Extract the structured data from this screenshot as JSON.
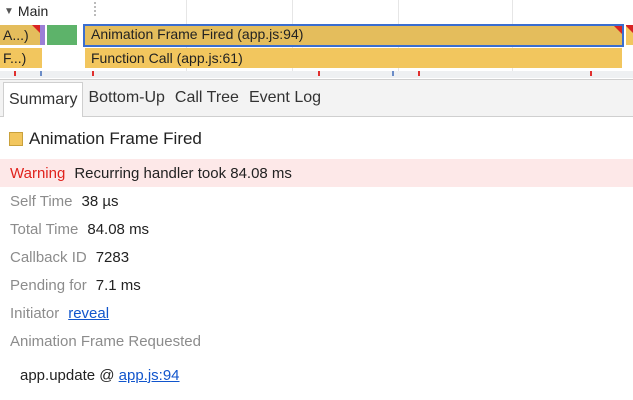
{
  "flame": {
    "main_label": "Main",
    "bars": {
      "left_top": "A...)",
      "left_bottom": "F...)",
      "animation_frame": "Animation Frame Fired (app.js:94)",
      "function_call": "Function Call (app.js:61)"
    }
  },
  "tabs": [
    "Summary",
    "Bottom-Up",
    "Call Tree",
    "Event Log"
  ],
  "summary": {
    "title": "Animation Frame Fired",
    "warning": {
      "label": "Warning",
      "value": "Recurring handler took 84.08 ms"
    },
    "self_time": {
      "label": "Self Time",
      "value": "38 µs"
    },
    "total_time": {
      "label": "Total Time",
      "value": "84.08 ms"
    },
    "callback_id": {
      "label": "Callback ID",
      "value": "7283"
    },
    "pending_for": {
      "label": "Pending for",
      "value": "7.1 ms"
    },
    "initiator": {
      "label": "Initiator",
      "link": "reveal"
    },
    "requested_heading": "Animation Frame Requested",
    "stack_frame": {
      "function": "app.update @",
      "link": "app.js:94"
    }
  },
  "colors": {
    "animation_bar": "#e4bd5c",
    "function_bar": "#f2c65e",
    "selection_border": "#3a6ed0",
    "warning_text": "#e0221c",
    "warning_bg": "#fde8e8",
    "link": "#1155cc",
    "swatch_yellow": "#f2c65e",
    "green_block": "#5db36a",
    "purple_block": "#9b7fd6"
  }
}
